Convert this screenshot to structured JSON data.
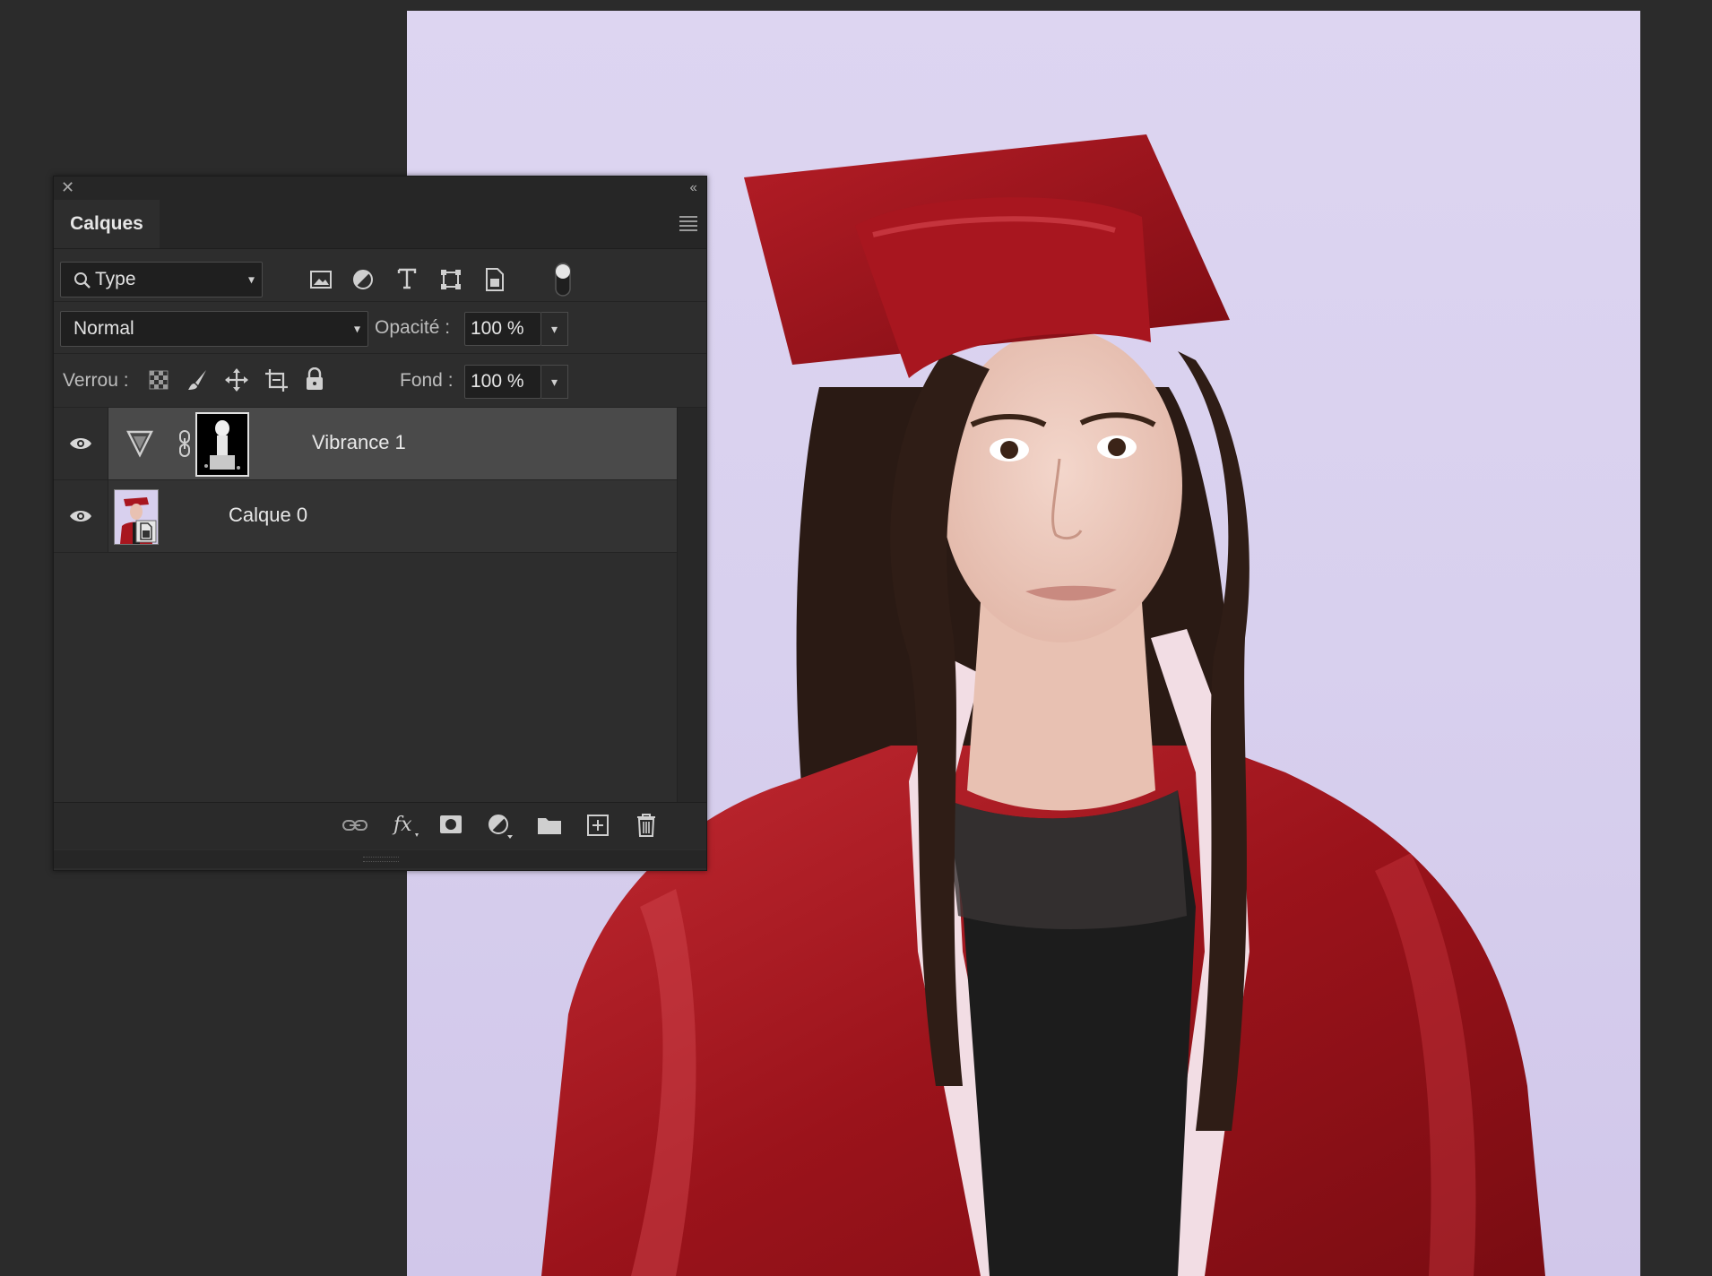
{
  "panel": {
    "tab_label": "Calques",
    "filter": {
      "kind_value": "Type"
    },
    "blend_mode": "Normal",
    "opacity": {
      "label": "Opacité :",
      "value": "100 %"
    },
    "lock": {
      "label": "Verrou :"
    },
    "fill": {
      "label": "Fond :",
      "value": "100 %"
    },
    "layers": [
      {
        "name": "Vibrance 1",
        "visible": true,
        "selected": true,
        "type": "adjustment"
      },
      {
        "name": "Calque 0",
        "visible": true,
        "selected": false,
        "type": "smart-object"
      }
    ]
  },
  "colors": {
    "panel_bg": "#2d2d2d",
    "selected_row": "#4a4a4a",
    "canvas_backdrop": "#d8d0ee",
    "gown_red": "#a0141c"
  }
}
